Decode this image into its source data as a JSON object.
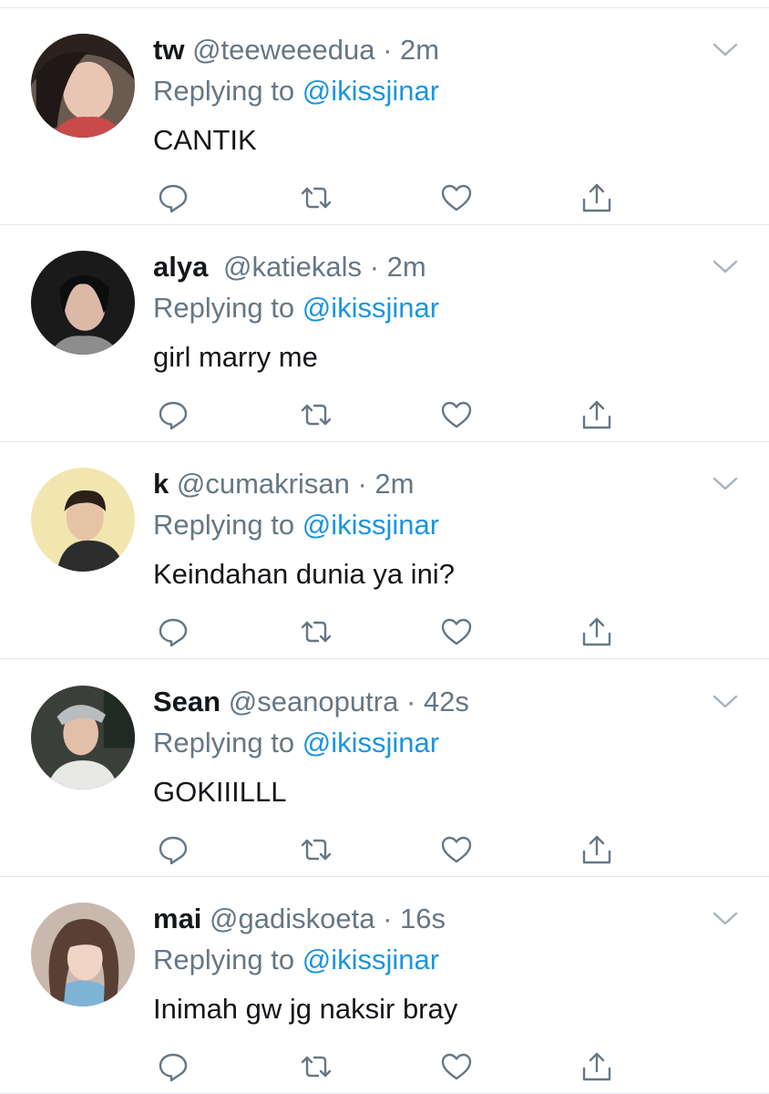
{
  "reply_label": "Replying to",
  "colors": {
    "text": "#14171a",
    "secondary": "#657786",
    "link": "#1b95e0",
    "icon": "#657786",
    "divider": "#e1e8ed"
  },
  "icons": [
    "reply-icon",
    "retweet-icon",
    "like-icon",
    "share-icon",
    "chevron-down-icon"
  ],
  "tweets": [
    {
      "name": "tw",
      "handle": "@teeweeedua",
      "dot": "·",
      "time": "2m",
      "mention": "@ikissjinar",
      "text": "CANTIK"
    },
    {
      "name": "alya",
      "handle": "@katiekals",
      "dot": "·",
      "time": "2m",
      "mention": "@ikissjinar",
      "text": "girl marry me"
    },
    {
      "name": "k",
      "handle": "@cumakrisan",
      "dot": "·",
      "time": "2m",
      "mention": "@ikissjinar",
      "text": "Keindahan dunia ya ini?"
    },
    {
      "name": "Sean",
      "handle": "@seanoputra",
      "dot": "·",
      "time": "42s",
      "mention": "@ikissjinar",
      "text": "GOKIIILLL"
    },
    {
      "name": "mai",
      "handle": "@gadiskoeta",
      "dot": "·",
      "time": "16s",
      "mention": "@ikissjinar",
      "text": "Inimah gw jg naksir bray"
    }
  ]
}
